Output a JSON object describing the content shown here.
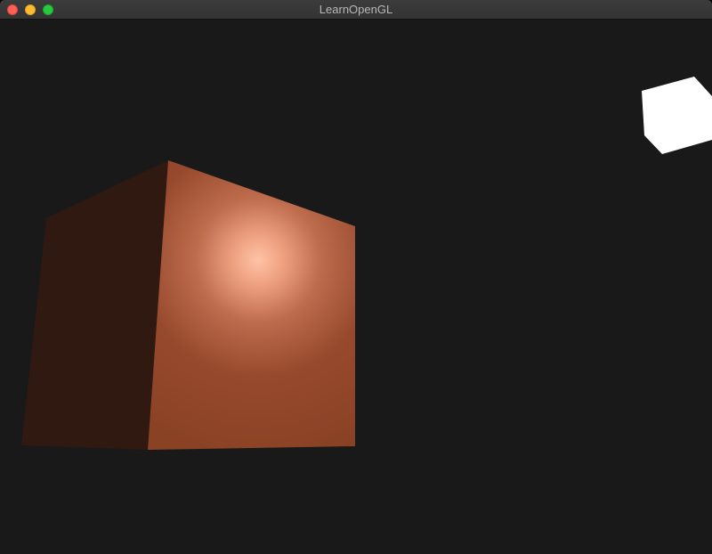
{
  "window": {
    "title": "LearnOpenGL",
    "controls": {
      "close": "close-icon",
      "minimize": "minimize-icon",
      "maximize": "maximize-icon"
    }
  },
  "scene": {
    "background_color": "#191919",
    "object_cube": {
      "dark_face_color": "#301911",
      "lit_face_color": "#8e4627",
      "specular_highlight_color": "#ffc3a6"
    },
    "light_cube": {
      "color": "#ffffff"
    }
  }
}
